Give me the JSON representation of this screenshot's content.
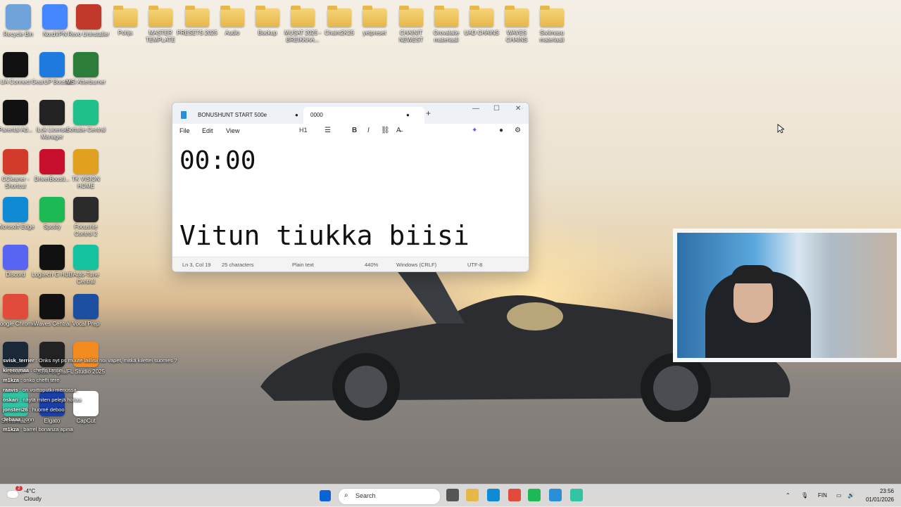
{
  "desktop": {
    "icons": [
      {
        "label": "Recycle Bin",
        "icon": "recycle-bin-icon",
        "color": "#6fa3d9"
      },
      {
        "label": "NordVPN",
        "icon": "nordvpn-icon",
        "color": "#4687ff"
      },
      {
        "label": "Revo Uninstaller",
        "icon": "revo-icon",
        "color": "#c0392b"
      },
      {
        "label": "Pohja",
        "icon": "folder-icon"
      },
      {
        "label": "MASTER TEMPLATE",
        "icon": "folder-icon"
      },
      {
        "label": "PRESETS 2025",
        "icon": "folder-icon"
      },
      {
        "label": "Audio",
        "icon": "folder-icon"
      },
      {
        "label": "Backup",
        "icon": "folder-icon"
      },
      {
        "label": "MUSAT 2025 - BREIKKAA...",
        "icon": "folder-icon"
      },
      {
        "label": "Chaint2K25",
        "icon": "folder-icon"
      },
      {
        "label": "yetpreset",
        "icon": "folder-icon"
      },
      {
        "label": "CHAINIT NEWEST",
        "icon": "folder-icon"
      },
      {
        "label": "Orovalaite materiaali",
        "icon": "folder-icon"
      },
      {
        "label": "UAD CHAINS",
        "icon": "folder-icon"
      },
      {
        "label": "WAVES CHAINS",
        "icon": "folder-icon"
      },
      {
        "label": "Siviimasu materiaali",
        "icon": "folder-icon"
      },
      {
        "label": "UA Connect",
        "icon": "ua-connect-icon",
        "color": "#111111"
      },
      {
        "label": "GearUP Booster",
        "icon": "gearup-icon",
        "color": "#1f7ae0"
      },
      {
        "label": "MSI Afterburner",
        "icon": "msi-icon",
        "color": "#2d7d3a"
      },
      {
        "label": "Parental Ad...",
        "icon": "parental-advisory-icon",
        "color": "#111111"
      },
      {
        "label": "iLok License Manager",
        "icon": "ilok-icon",
        "color": "#222222"
      },
      {
        "label": "Softube Central",
        "icon": "softube-icon",
        "color": "#20c08a"
      },
      {
        "label": "CCleaner - Shortcut",
        "icon": "ccleaner-icon",
        "color": "#d23a2a"
      },
      {
        "label": "DriverBoosti...",
        "icon": "driverbooster-icon",
        "color": "#c8102e"
      },
      {
        "label": "TK VISION HOME",
        "icon": "tk-vision-icon",
        "color": "#e0a020"
      },
      {
        "label": "Microsoft Edge",
        "icon": "edge-icon",
        "color": "#0f8bd6"
      },
      {
        "label": "Spotify",
        "icon": "spotify-icon",
        "color": "#1db954"
      },
      {
        "label": "Focusrite Control 2",
        "icon": "focusrite-icon",
        "color": "#2b2b2b"
      },
      {
        "label": "Discord",
        "icon": "discord-icon",
        "color": "#5865f2"
      },
      {
        "label": "Logitech G HUB",
        "icon": "logitech-icon",
        "color": "#111111"
      },
      {
        "label": "Auto-Tune Central",
        "icon": "autotune-icon",
        "color": "#16c3a0"
      },
      {
        "label": "Google Chrome",
        "icon": "chrome-icon",
        "color": "#e14b3b"
      },
      {
        "label": "Waves Central",
        "icon": "waves-icon",
        "color": "#111111"
      },
      {
        "label": "Vocal Prep",
        "icon": "vocal-prep-icon",
        "color": "#1d4fa0"
      },
      {
        "label": "Steam",
        "icon": "steam-icon",
        "color": "#1b2838"
      },
      {
        "label": "Slate Digital",
        "icon": "slate-digital-icon",
        "color": "#222222"
      },
      {
        "label": "FL Studio 2025",
        "icon": "fl-studio-icon",
        "color": "#f28b20"
      },
      {
        "label": "Streamlabs",
        "icon": "streamlabs-icon",
        "color": "#31c3a2"
      },
      {
        "label": "Elgato",
        "icon": "elgato-icon",
        "color": "#1a3fa8"
      },
      {
        "label": "CapCut",
        "icon": "capcut-icon",
        "color": "#ffffff"
      }
    ]
  },
  "notepad": {
    "tabs": [
      {
        "label": "BONUSHUNT START 500e",
        "dot": "●"
      },
      {
        "label": "0000",
        "dot": "●"
      }
    ],
    "new_tab": "+",
    "controls": {
      "minimize": "—",
      "maximize": "☐",
      "close": "✕"
    },
    "menu": [
      "File",
      "Edit",
      "View"
    ],
    "toolbar": {
      "heading": "H1",
      "bold": "B",
      "italic": "I"
    },
    "lines": [
      "00:00",
      "",
      "Vitun tiukka biisi"
    ],
    "status": {
      "position": "Ln 3, Col 19",
      "characters": "25 characters",
      "format": "Plain text",
      "zoom": "440%",
      "line_endings": "Windows (CRLF)",
      "encoding": "UTF-8"
    }
  },
  "chat": [
    {
      "user": "svisk_terrier",
      "text": "Onks nyt ps muute laillisii noi vapet, mitkä kilettei suomes ?"
    },
    {
      "user": "kireenmaa",
      "text": "cheffo tansei"
    },
    {
      "user": "m1kza",
      "text": "onko cheffi tere"
    },
    {
      "user": "raavis",
      "text": "on voittoputki menossa"
    },
    {
      "user": "oskari",
      "text": "näytä miten pelejä hoitaa"
    },
    {
      "user": "jonsteri26",
      "text": "huomé deboo"
    },
    {
      "user": "Jebaaa",
      "text": "onn"
    },
    {
      "user": "m1kza",
      "text": "barrel bonanza apina"
    }
  ],
  "taskbar": {
    "weather": {
      "temp": "-4°C",
      "desc": "Cloudy",
      "badge": "2"
    },
    "search_placeholder": "Search",
    "apps": [
      {
        "name": "windows-start-icon",
        "color": "#0a64d8"
      },
      {
        "name": "task-view-icon",
        "color": "#555555"
      },
      {
        "name": "file-explorer-icon",
        "color": "#e6b84a"
      },
      {
        "name": "edge-taskbar-icon",
        "color": "#0f8bd6"
      },
      {
        "name": "chrome-taskbar-icon",
        "color": "#e14b3b"
      },
      {
        "name": "spotify-taskbar-icon",
        "color": "#1db954"
      },
      {
        "name": "notepad-taskbar-icon",
        "color": "#2a8fd8"
      },
      {
        "name": "streamlabs-taskbar-icon",
        "color": "#31c3a2"
      }
    ],
    "language": "FIN",
    "time": "23:56",
    "date": "01/01/2026"
  }
}
